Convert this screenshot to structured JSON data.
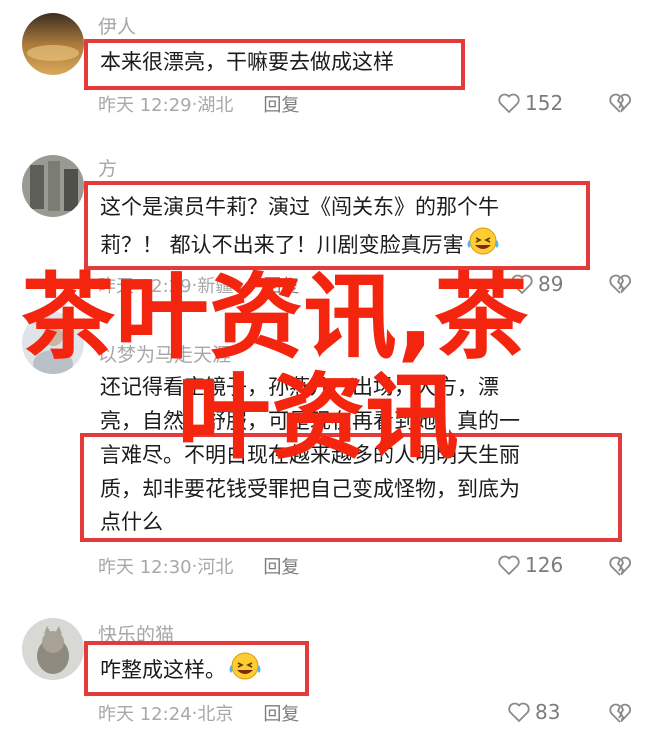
{
  "comments": [
    {
      "username": "伊人",
      "lines": [
        "本来很漂亮，干嘛要去做成这样"
      ],
      "time": "昨天 12:29",
      "location": "湖北",
      "reply_label": "回复",
      "likes": "152"
    },
    {
      "username": "方",
      "lines": [
        "这个是演员牛莉？演过《闯关东》的那个牛",
        "莉？！ 都认不出来了！川剧变脸真厉害"
      ],
      "emoji": "laughing-tears-emoji",
      "time": "昨天 12:29",
      "location": "新疆",
      "reply_label": "回复",
      "likes": "89"
    },
    {
      "username": "以梦为马走天涯",
      "lines": [
        "还记得看空镜子，孙燕儿一出场，大方，漂",
        "亮，自然，舒服，可是现在再看到她，真的一",
        "言难尽。不明白现在越来越多的人明明天生丽",
        "质，却非要花钱受罪把自己变成怪物，到底为",
        "点什么"
      ],
      "time": "昨天 12:30",
      "location": "河北",
      "reply_label": "回复",
      "likes": "126"
    },
    {
      "username": "快乐的猫",
      "lines": [
        "咋整成这样。"
      ],
      "emoji": "laughing-tears-emoji",
      "time": "昨天 12:24",
      "location": "北京",
      "reply_label": "回复",
      "likes": "83"
    }
  ],
  "watermark": {
    "line1": "茶叶资讯,茶",
    "line2": "叶资讯"
  },
  "colors": {
    "highlight": "#e53a3a",
    "watermark": "#f4250f",
    "meta": "#a8a8a8"
  }
}
